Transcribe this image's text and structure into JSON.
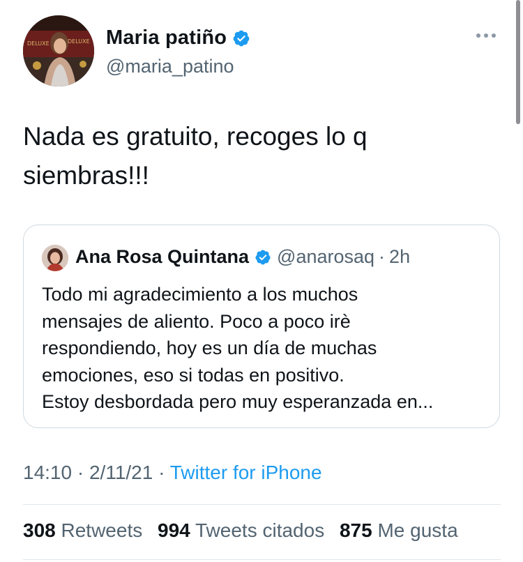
{
  "author": {
    "name": "Maria patiño",
    "handle": "@maria_patino",
    "verified": true,
    "avatar_text": "DELUXE"
  },
  "tweet": {
    "line1": "Nada es gratuito, recoges lo q",
    "line2": "siembras!!!"
  },
  "quoted": {
    "name": "Ana Rosa Quintana",
    "handle": "@anarosaq",
    "separator": "·",
    "time": "2h",
    "lines": [
      "Todo mi agradecimiento a los muchos",
      "mensajes de aliento. Poco a poco irè",
      "respondiendo, hoy es un día de muchas",
      "emociones, eso si todas en positivo.",
      "Estoy desbordada pero muy esperanzada en..."
    ]
  },
  "meta": {
    "time": "14:10",
    "sep1": "·",
    "date": "2/11/21",
    "sep2": "·",
    "source": "Twitter for iPhone"
  },
  "stats": {
    "retweets_count": "308",
    "retweets_label": "Retweets",
    "quotes_count": "994",
    "quotes_label": "Tweets citados",
    "likes_count": "875",
    "likes_label": "Me gusta"
  },
  "colors": {
    "accent": "#1d9bf0",
    "secondary_text": "#536471",
    "border": "#cfd9de"
  },
  "icons": {
    "verified": "verified-badge-icon",
    "more": "more-options-icon"
  }
}
